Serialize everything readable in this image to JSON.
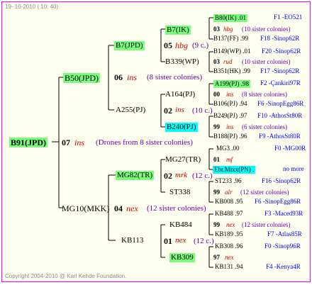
{
  "header_date": "19- 10-2010 ( 10: 40)",
  "footer": "Copyright 2004-2010 @ Karl Kehde Foundation.",
  "root": "B91(JPD)",
  "root_year": "07",
  "root_queen": "ins",
  "root_note": "(Drones from 8 sister colonies)",
  "level1": [
    {
      "name": "B50(JPD)",
      "year": "06",
      "queen": "ins",
      "note": "(8 sister colonies)"
    },
    {
      "name": "MG10(MKK)",
      "year": "04",
      "queen": "nex",
      "note": "(12 sister colonies)"
    }
  ],
  "level2": [
    {
      "name": "B7(JPD)",
      "year": "05",
      "queen": "hbg",
      "note": "(9 c.)"
    },
    {
      "name": "A255(PJ)",
      "year": "02",
      "queen": "ins",
      "note": "(10 c.)"
    },
    {
      "name": "MG82(TR)",
      "year": "02",
      "queen": "mrk",
      "note": "(12 c.)"
    },
    {
      "name": "KB113",
      "year": "01",
      "queen": "nex",
      "note": "(12 c.)"
    }
  ],
  "level3": [
    {
      "name": "B7(IK)"
    },
    {
      "name": "B339(WP)"
    },
    {
      "name": "A164(PJ)"
    },
    {
      "name": "B240(PJ)"
    },
    {
      "name": "MG27(TR)"
    },
    {
      "name": "ST338"
    },
    {
      "name": "KB484"
    },
    {
      "name": "KB309"
    }
  ],
  "level4": [
    {
      "a": "B80(IK) .01",
      "b": "F1 -EO521"
    },
    {
      "a": "03",
      "q": "hbg",
      "note": "(10 sister colonies)"
    },
    {
      "a": "B137(FF) .99",
      "b": "F18 -Sinop62R"
    },
    {
      "a": "B149(WP) .01",
      "b": "F20 -Sinop62R"
    },
    {
      "a": "03",
      "q": "rud",
      "note": "(10 sister colonies)"
    },
    {
      "a": "B351(HK) .99",
      "b": "F17 -Sinop62R"
    },
    {
      "a": "A199(PJ) .98",
      "b": "F2 -Çankiri97R"
    },
    {
      "a": "00",
      "q": "ins",
      "note": "(8 sister colonies)"
    },
    {
      "a": "B106(PJ) .94",
      "b": "F6 -SinopEgg86R"
    },
    {
      "a": "B249(PJ) .97",
      "b": "F10 -AthosSt80R"
    },
    {
      "a": "99",
      "q": "ins",
      "note": "(6 sister colonies)"
    },
    {
      "a": "B188(PJ) .96",
      "b": "F9 -AthosSt80R"
    },
    {
      "a": "MG3 .00",
      "b": "F0 -MG00R"
    },
    {
      "a": "01",
      "q": "mf",
      "note": ""
    },
    {
      "a": "Ebr.Mixx(PN) .",
      "b": "no more"
    },
    {
      "a": "ST233 .96",
      "b": "F16 -Sinop62R"
    },
    {
      "a": "99",
      "q": "alr",
      "note": "(12 sister colonies)"
    },
    {
      "a": "KB008 .95",
      "b": "F6 -SinopEgg86R"
    },
    {
      "a": "KB488 .97",
      "b": "F3 -Maced93R"
    },
    {
      "a": "99",
      "q": "nex",
      "note": "(12 sister colonies)"
    },
    {
      "a": "KB189 .95",
      "b": "F7 -Atlas85R"
    },
    {
      "a": "KB308 .96",
      "b": "F0 -Sinop96R"
    },
    {
      "a": "97",
      "q": "nex",
      "note": ""
    },
    {
      "a": "KB131 .94",
      "b": "F4 -Kenya4R"
    }
  ]
}
